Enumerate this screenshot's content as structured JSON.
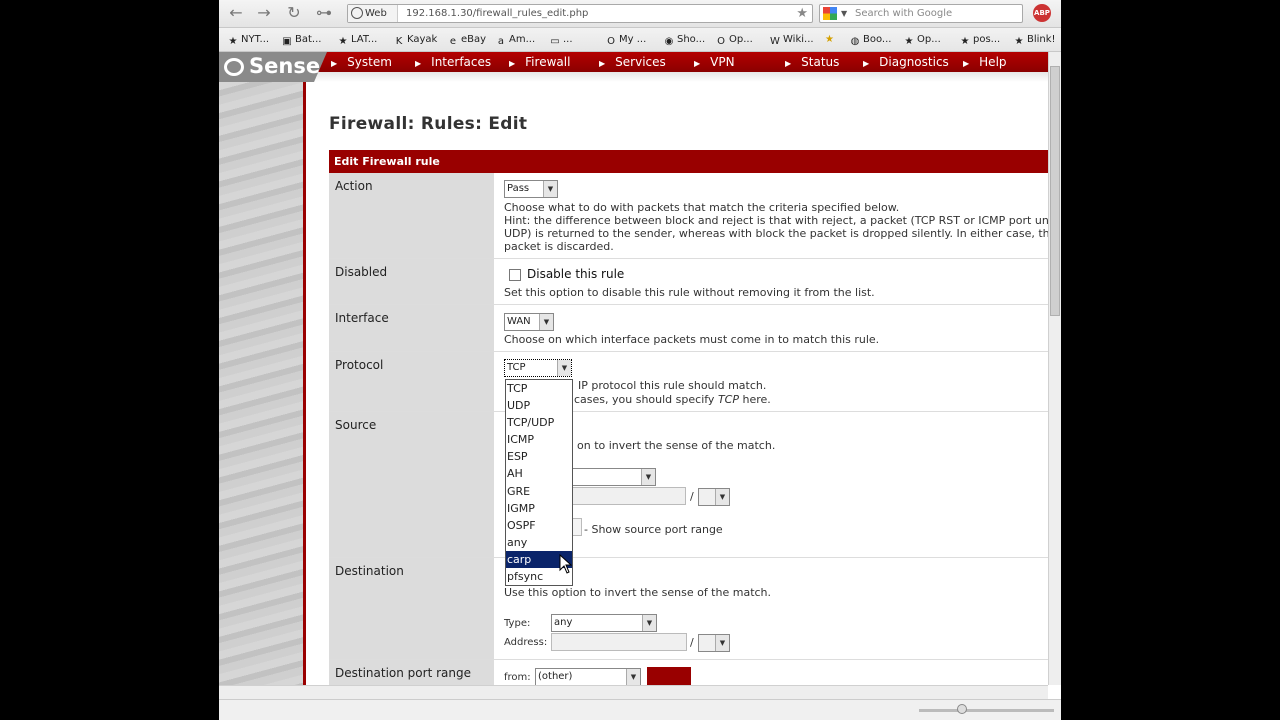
{
  "browser": {
    "url_label": "Web",
    "url": "192.168.1.30/firewall_rules_edit.php",
    "search_placeholder": "Search with Google",
    "abp_label": "ABP",
    "bookmarks": [
      {
        "label": "NYT...",
        "icon": "★"
      },
      {
        "label": "Bat...",
        "icon": "▣"
      },
      {
        "label": "LAT...",
        "icon": "★"
      },
      {
        "label": "Kayak",
        "icon": "K"
      },
      {
        "label": "eBay",
        "icon": "e"
      },
      {
        "label": "Am...",
        "icon": "a"
      },
      {
        "label": "...",
        "icon": "▭"
      },
      {
        "label": "My ...",
        "icon": "O"
      },
      {
        "label": "Sho...",
        "icon": "◉"
      },
      {
        "label": "Op...",
        "icon": "O"
      },
      {
        "label": "Wiki...",
        "icon": "W"
      },
      {
        "label": "Boo...",
        "icon": "◍"
      },
      {
        "label": "Op...",
        "icon": "★"
      },
      {
        "label": "pos...",
        "icon": "★"
      },
      {
        "label": "Blink!",
        "icon": "★"
      }
    ]
  },
  "app": {
    "logo": "Sense",
    "nav": [
      "System",
      "Interfaces",
      "Firewall",
      "Services",
      "VPN",
      "Status",
      "Diagnostics",
      "Help"
    ],
    "page_title": "Firewall: Rules: Edit",
    "section_title": "Edit Firewall rule"
  },
  "form": {
    "action": {
      "label": "Action",
      "value": "Pass",
      "desc1": "Choose what to do with packets that match the criteria specified below.",
      "desc2": "Hint: the difference between block and reject is that with reject, a packet (TCP RST or ICMP port unrea",
      "desc3": "UDP) is returned to the sender, whereas with block the packet is dropped silently. In either case, the ori",
      "desc4": "packet is discarded."
    },
    "disabled": {
      "label": "Disabled",
      "checkbox_label": "Disable this rule",
      "desc": "Set this option to disable this rule without removing it from the list."
    },
    "interface": {
      "label": "Interface",
      "value": "WAN",
      "desc": "Choose on which interface packets must come in to match this rule."
    },
    "protocol": {
      "label": "Protocol",
      "value": "TCP",
      "desc1": "IP protocol this rule should match.",
      "desc2": "cases, you should specify",
      "desc2_em": "TCP",
      "desc2_end": "here.",
      "options": [
        "TCP",
        "UDP",
        "TCP/UDP",
        "ICMP",
        "ESP",
        "AH",
        "GRE",
        "IGMP",
        "OSPF",
        "any",
        "carp",
        "pfsync"
      ],
      "highlighted": "carp"
    },
    "source": {
      "label": "Source",
      "desc": "on to invert the sense of the match.",
      "slash": "/",
      "port_range_link": "- Show source port range"
    },
    "destination": {
      "label": "Destination",
      "desc": "Use this option to invert the sense of the match.",
      "type_label": "Type:",
      "type_value": "any",
      "address_label": "Address:",
      "slash": "/"
    },
    "dest_port": {
      "label": "Destination port range",
      "from_label": "from:",
      "from_value": "(other)"
    }
  }
}
